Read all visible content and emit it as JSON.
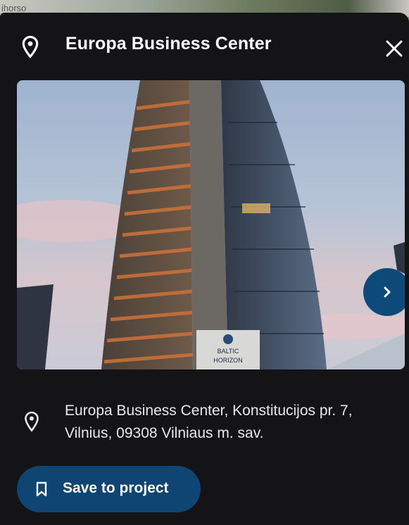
{
  "map": {
    "label": "ihorso"
  },
  "header": {
    "title": "Europa Business Center"
  },
  "photo": {
    "sign_line1": "BALTIC",
    "sign_line2": "HORIZON"
  },
  "address": {
    "text": "Europa Business Center, Konstitucijos pr. 7, Vilnius, 09308 Vilniaus m. sav."
  },
  "actions": {
    "save_label": "Save to project"
  },
  "colors": {
    "panel": "#141416",
    "accent": "#0f4572",
    "text": "#ffffff"
  },
  "icons": {
    "place": "location-pin-icon",
    "close": "close-icon",
    "next": "chevron-right-icon",
    "save": "bookmark-icon"
  }
}
